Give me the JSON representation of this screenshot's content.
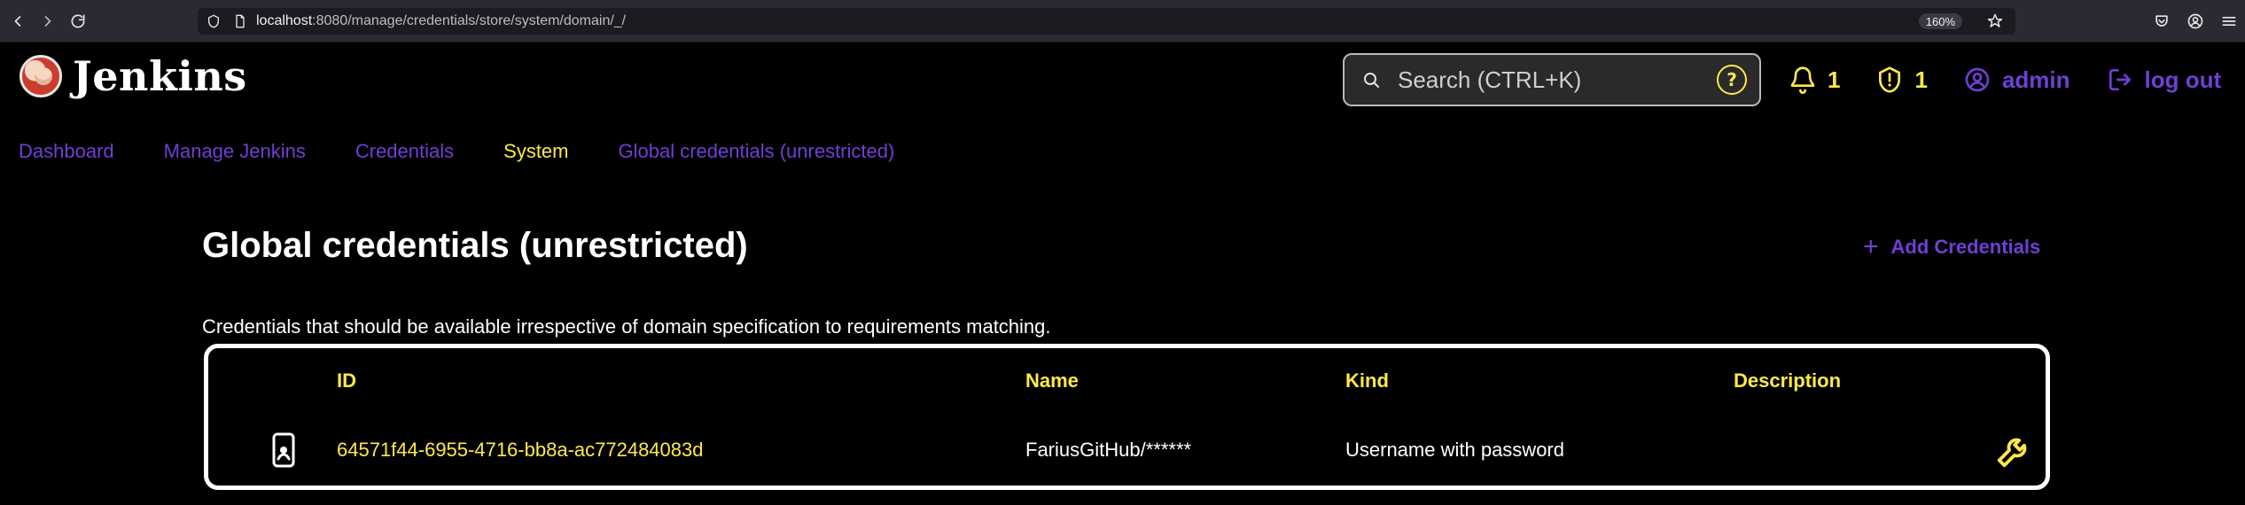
{
  "browser": {
    "url_host": "localhost",
    "url_path": ":8080/manage/credentials/store/system/domain/_/",
    "zoom": "160%"
  },
  "app": {
    "brand": "Jenkins"
  },
  "header": {
    "search": {
      "placeholder": "Search (CTRL+K)",
      "value": ""
    },
    "help_label": "?",
    "notifications_count": "1",
    "security_count": "1",
    "user_label": "admin",
    "logout_label": "log out"
  },
  "breadcrumb": [
    {
      "label": "Dashboard"
    },
    {
      "label": "Manage Jenkins"
    },
    {
      "label": "Credentials"
    },
    {
      "label": "System"
    },
    {
      "label": "Global credentials (unrestricted)"
    }
  ],
  "page": {
    "title": "Global credentials (unrestricted)",
    "add_label": "Add Credentials",
    "description": "Credentials that should be available irrespective of domain specification to requirements matching."
  },
  "table": {
    "columns": [
      "ID",
      "Name",
      "Kind",
      "Description"
    ],
    "rows": [
      {
        "id": "64571f44-6955-4716-bb8a-ac772484083d",
        "name": "FariusGitHub/******",
        "kind": "Username with password",
        "description": ""
      }
    ]
  },
  "colors": {
    "background": "#000000",
    "accent_yellow": "#ffe94a",
    "accent_purple": "#6f3fd3",
    "text_white": "#ffffff"
  }
}
